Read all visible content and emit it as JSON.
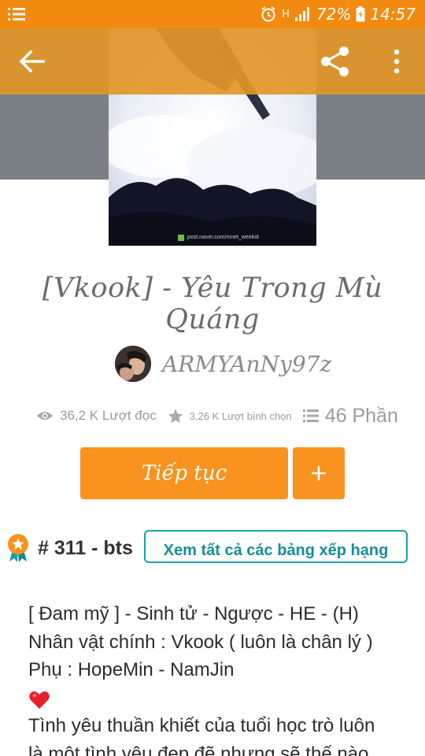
{
  "status_bar": {
    "battery": "72%",
    "time": "14:57",
    "network_label": "H",
    "icons": [
      "menu-icon",
      "alarm-icon",
      "signal-icon",
      "battery-icon"
    ],
    "background": "#f28a0f"
  },
  "toolbar": {
    "icons": [
      "back-arrow-icon",
      "share-icon",
      "more-vert-icon"
    ],
    "background": "#e2962a"
  },
  "cover": {
    "watermark": "post.naver.com/mnet_weekid"
  },
  "story": {
    "title": "[Vkook] - Yêu Trong Mù Quáng",
    "author": "ARMYAnNy97z"
  },
  "stats": {
    "reads": "36,2 K Lượt đọc",
    "votes": "3,26 K Lượt bình chọn",
    "parts": "46 Phần"
  },
  "actions": {
    "continue_label": "Tiếp tục",
    "add_label": "+",
    "accent": "#f7931e"
  },
  "ranking": {
    "rank": "# 311",
    "separator": " - ",
    "tag": "bts",
    "see_all_label": "Xem tất cả các bảng xếp hạng",
    "accent": "#19a1a9"
  },
  "description": {
    "lines": [
      "[ Đam mỹ ] - Sinh tử - Ngược - HE - (H)",
      "Nhân vật chính : Vkook ( luôn là chân lý )",
      "Phụ : HopeMin - NamJin",
      "Tình yêu thuần khiết của tuổi học trò luôn",
      "là một tình yêu đẹp đẽ nhưng sẽ thế nào"
    ]
  }
}
